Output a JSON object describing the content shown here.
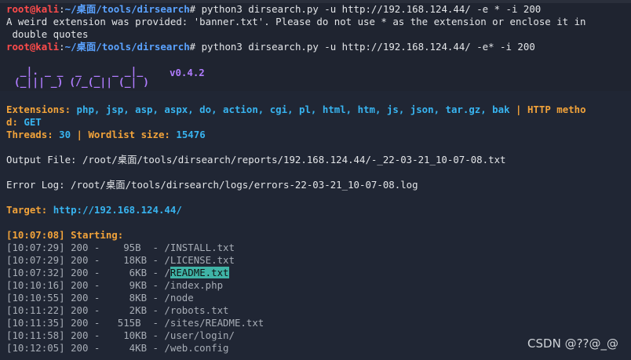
{
  "prompt": {
    "user_host": "root@kali",
    "sep": ":",
    "path": "~/桌面/tools/dirsearch",
    "hash": "#"
  },
  "commands": {
    "first": " python3 dirsearch.py -u http://192.168.124.44/ -e * -i 200",
    "second": " python3 dirsearch.py -u http://192.168.124.44/ -e* -i 200"
  },
  "messages": {
    "warning_line1": "A weird extension was provided: 'banner.txt'. Please do not use * as the extension or enclose it in",
    "warning_line2": " double quotes"
  },
  "banner": {
    "art_line1": "  _|. _ _  _  _  _ _|_",
    "art_line2": " (_||| _) (/_(_|| (_| )",
    "version": "v0.4.2"
  },
  "config": {
    "ext_label": "Extensions: ",
    "ext_value": "php, jsp, asp, aspx, do, action, cgi, pl, html, htm, js, json, tar.gz, bak",
    "pipe": " | ",
    "http_label_a": "HTTP metho",
    "http_label_b": "d: ",
    "http_value": "GET",
    "threads_label": "Threads: ",
    "threads_value": "30",
    "wordlist_label": "Wordlist size: ",
    "wordlist_value": "15476",
    "output_file": "Output File: /root/桌面/tools/dirsearch/reports/192.168.124.44/-_22-03-21_10-07-08.txt",
    "error_log": "Error Log: /root/桌面/tools/dirsearch/logs/errors-22-03-21_10-07-08.log",
    "target_label": "Target: ",
    "target_value": "http://192.168.124.44/",
    "start_time": "[10:07:08]",
    "start_text": " Starting:"
  },
  "results": [
    {
      "time": "[10:07:29]",
      "status": " 200 - ",
      "size": "   95B ",
      "path": " - /INSTALL.txt"
    },
    {
      "time": "[10:07:29]",
      "status": " 200 - ",
      "size": "   18KB",
      "path": " - /LICENSE.txt"
    },
    {
      "time": "[10:07:32]",
      "status": " 200 - ",
      "size": "    6KB",
      "path": " - /",
      "highlight": "README.txt"
    },
    {
      "time": "[10:10:16]",
      "status": " 200 - ",
      "size": "    9KB",
      "path": " - /index.php"
    },
    {
      "time": "[10:10:55]",
      "status": " 200 - ",
      "size": "    8KB",
      "path": " - /node"
    },
    {
      "time": "[10:11:22]",
      "status": " 200 - ",
      "size": "    2KB",
      "path": " - /robots.txt"
    },
    {
      "time": "[10:11:35]",
      "status": " 200 - ",
      "size": "  515B ",
      "path": " - /sites/README.txt"
    },
    {
      "time": "[10:11:58]",
      "status": " 200 - ",
      "size": "   10KB",
      "path": " - /user/login/"
    },
    {
      "time": "[10:12:05]",
      "status": " 200 - ",
      "size": "    4KB",
      "path": " - /web.config"
    }
  ],
  "watermark": "CSDN @??@_@"
}
